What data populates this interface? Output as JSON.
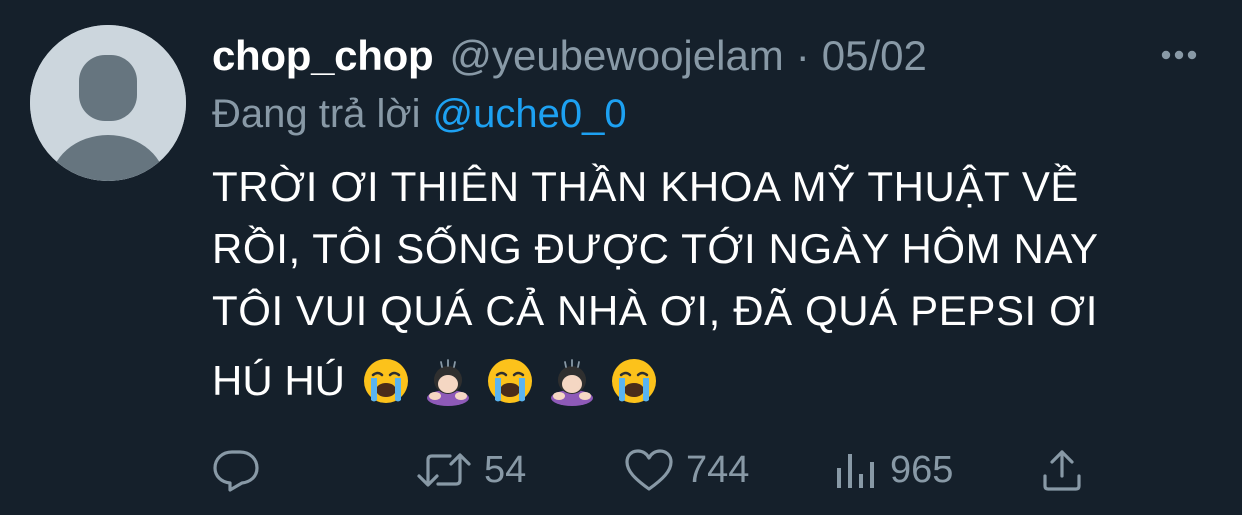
{
  "tweet": {
    "display_name": "chop_chop",
    "handle": "@yeubewoojelam",
    "separator": "·",
    "date": "05/02",
    "reply_prefix": "Đang trả lời",
    "reply_target": "@uche0_0",
    "text_lines": [
      "TRỜI ƠI THIÊN THẦN KHOA MỸ THUẬT VỀ",
      "RỒI, TÔI SỐNG ĐƯỢC TỚI NGÀY HÔM NAY",
      "TÔI VUI QUÁ CẢ NHÀ ƠI, ĐÃ QUÁ PEPSI ƠI",
      "HÚ HÚ"
    ],
    "emojis": [
      "crying-face",
      "bowing-woman",
      "crying-face",
      "bowing-woman",
      "crying-face"
    ]
  },
  "actions": {
    "reply_icon": "reply-icon",
    "retweet_icon": "retweet-icon",
    "retweet_count": "54",
    "like_icon": "heart-icon",
    "like_count": "744",
    "views_icon": "analytics-icon",
    "views_count": "965",
    "share_icon": "share-icon"
  },
  "colors": {
    "background": "#15202b",
    "text": "#ffffff",
    "secondary": "#8899a6",
    "link": "#1da1f2",
    "avatar_bg": "#ccd6dd",
    "avatar_fg": "#66757f"
  }
}
